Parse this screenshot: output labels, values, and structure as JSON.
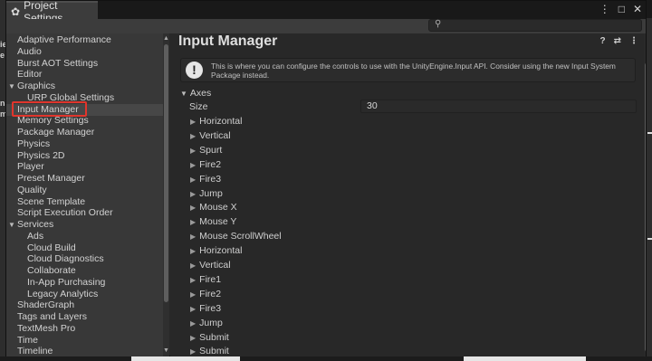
{
  "window": {
    "tab_title": "Project Settings",
    "tab_icon": "gear-icon",
    "controls": [
      "⋮",
      "□",
      "✕"
    ],
    "search_placeholder": ""
  },
  "background_fragments": {
    "left_text": [
      "ie",
      "e",
      "ns",
      "m"
    ]
  },
  "sidebar": {
    "items": [
      {
        "label": "Adaptive Performance",
        "indent": 0
      },
      {
        "label": "Audio",
        "indent": 0
      },
      {
        "label": "Burst AOT Settings",
        "indent": 0
      },
      {
        "label": "Editor",
        "indent": 0
      },
      {
        "label": "Graphics",
        "indent": 0,
        "expanded": true
      },
      {
        "label": "URP Global Settings",
        "indent": 1
      },
      {
        "label": "Input Manager",
        "indent": 0,
        "selected": true
      },
      {
        "label": "Memory Settings",
        "indent": 0
      },
      {
        "label": "Package Manager",
        "indent": 0
      },
      {
        "label": "Physics",
        "indent": 0
      },
      {
        "label": "Physics 2D",
        "indent": 0
      },
      {
        "label": "Player",
        "indent": 0
      },
      {
        "label": "Preset Manager",
        "indent": 0
      },
      {
        "label": "Quality",
        "indent": 0
      },
      {
        "label": "Scene Template",
        "indent": 0
      },
      {
        "label": "Script Execution Order",
        "indent": 0
      },
      {
        "label": "Services",
        "indent": 0,
        "expanded": true
      },
      {
        "label": "Ads",
        "indent": 1
      },
      {
        "label": "Cloud Build",
        "indent": 1
      },
      {
        "label": "Cloud Diagnostics",
        "indent": 1
      },
      {
        "label": "Collaborate",
        "indent": 1
      },
      {
        "label": "In-App Purchasing",
        "indent": 1
      },
      {
        "label": "Legacy Analytics",
        "indent": 1
      },
      {
        "label": "ShaderGraph",
        "indent": 0
      },
      {
        "label": "Tags and Layers",
        "indent": 0
      },
      {
        "label": "TextMesh Pro",
        "indent": 0
      },
      {
        "label": "Time",
        "indent": 0
      },
      {
        "label": "Timeline",
        "indent": 0
      }
    ]
  },
  "main": {
    "title": "Input Manager",
    "title_icons": [
      "?",
      "⇄",
      "⋮"
    ],
    "info_icon": "!",
    "info_text": "This is where you can configure the controls to use with the UnityEngine.Input API. Consider using the new Input System Package instead.",
    "axes_label": "Axes",
    "size_label": "Size",
    "size_value": "30",
    "axes": [
      "Horizontal",
      "Vertical",
      "Spurt",
      "Fire2",
      "Fire3",
      "Jump",
      "Mouse X",
      "Mouse Y",
      "Mouse ScrollWheel",
      "Horizontal",
      "Vertical",
      "Fire1",
      "Fire2",
      "Fire3",
      "Jump",
      "Submit",
      "Submit"
    ]
  },
  "colors": {
    "selection_outline": "#e0352c",
    "sidebar_bg": "#383838",
    "main_bg": "#282828"
  }
}
